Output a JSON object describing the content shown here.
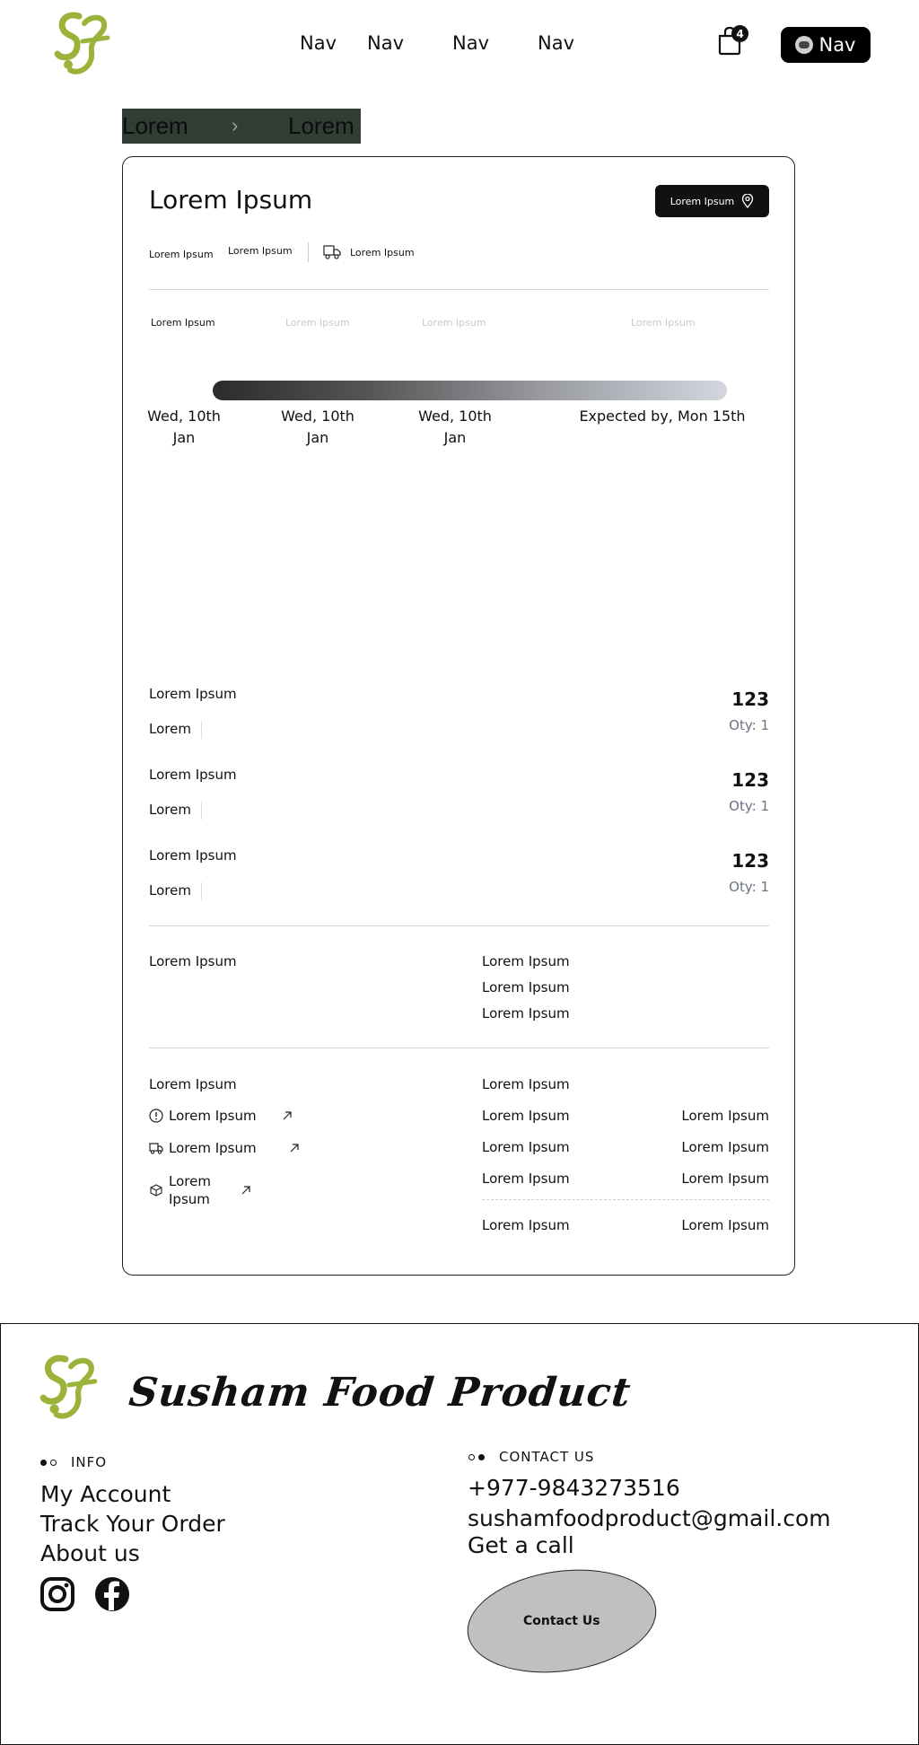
{
  "header": {
    "nav_items": [
      "Nav",
      "Nav",
      "Nav",
      "Nav"
    ],
    "cart_count": "4",
    "account_button_label": "Nav"
  },
  "breadcrumb": {
    "first": "Lorem",
    "second": "Lorem"
  },
  "order": {
    "title": "Lorem Ipsum",
    "location_button_label": "Lorem Ipsum",
    "meta": [
      "Lorem Ipsum",
      "Lorem Ipsum",
      "Lorem Ipsum"
    ],
    "steps": [
      {
        "label": "Lorem Ipsum",
        "date_line1": "Wed, 10th",
        "date_line2": "Jan"
      },
      {
        "label": "Lorem Ipsum",
        "date_line1": "Wed, 10th",
        "date_line2": "Jan"
      },
      {
        "label": "Lorem Ipsum",
        "date_line1": "Wed, 10th",
        "date_line2": "Jan"
      },
      {
        "label": "Lorem Ipsum",
        "date_line1": "Expected by, Mon 15th",
        "date_line2": ""
      }
    ],
    "progress_fraction": 1.0,
    "items": [
      {
        "name": "Lorem Ipsum",
        "sub": "Lorem",
        "price": "123",
        "qty": "Oty: 1"
      },
      {
        "name": "Lorem Ipsum",
        "sub": "Lorem",
        "price": "123",
        "qty": "Oty: 1"
      },
      {
        "name": "Lorem Ipsum",
        "sub": "Lorem",
        "price": "123",
        "qty": "Oty: 1"
      }
    ],
    "address": {
      "left": "Lorem Ipsum",
      "right": [
        "Lorem Ipsum",
        "Lorem Ipsum",
        "Lorem Ipsum"
      ]
    },
    "help": {
      "heading": "Lorem Ipsum",
      "links": [
        "Lorem Ipsum",
        "Lorem Ipsum",
        "Lorem\nIpsum"
      ]
    },
    "summary": {
      "heading": "Lorem Ipsum",
      "rows": [
        {
          "label": "Lorem Ipsum",
          "value": "Lorem Ipsum"
        },
        {
          "label": "Lorem Ipsum",
          "value": "Lorem Ipsum"
        },
        {
          "label": "Lorem Ipsum",
          "value": "Lorem Ipsum"
        }
      ],
      "total": {
        "label": "Lorem Ipsum",
        "value": "Lorem Ipsum"
      }
    }
  },
  "footer": {
    "brand": "Susham Food Product",
    "info_heading": "INFO",
    "info_links": [
      "My Account",
      "Track Your Order",
      "About us"
    ],
    "contact_heading": "CONTACT US",
    "phone": "+977-9843273516",
    "email": "sushamfoodproduct@gmail.com",
    "get_call": "Get a call",
    "contact_button": "Contact Us"
  },
  "colors": {
    "logo_green": "#9bb33a",
    "breadcrumb_bg": "#2f3d34"
  }
}
